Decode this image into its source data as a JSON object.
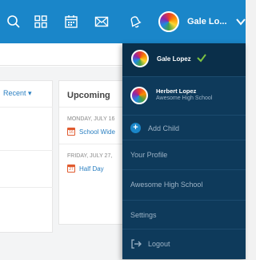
{
  "header": {
    "user_name": "Gale Lo...",
    "icons": [
      "search-icon",
      "grid-icon",
      "calendar-icon",
      "mail-icon",
      "bell-icon",
      "chevron-down-icon"
    ]
  },
  "background": {
    "filter_label": "Recent ▾",
    "upcoming": {
      "title": "Upcoming",
      "events": [
        {
          "date": "MONDAY, JULY 16",
          "cal_day": "16",
          "title": "School Wide"
        },
        {
          "date": "FRIDAY, JULY 27,",
          "cal_day": "27",
          "title": "Half Day"
        }
      ]
    }
  },
  "dropdown": {
    "current_user": {
      "name": "Gale Lopez"
    },
    "other_user": {
      "name": "Herbert Lopez",
      "school": "Awesome High School"
    },
    "add_child_label": "Add Child",
    "profile_label": "Your Profile",
    "school_label": "Awesome High School",
    "settings_label": "Settings",
    "logout_label": "Logout"
  },
  "colors": {
    "topbar": "#1a86c9",
    "dropdown_bg": "#0e3a5b",
    "check": "#7cc242",
    "link": "#2a7fc1"
  }
}
